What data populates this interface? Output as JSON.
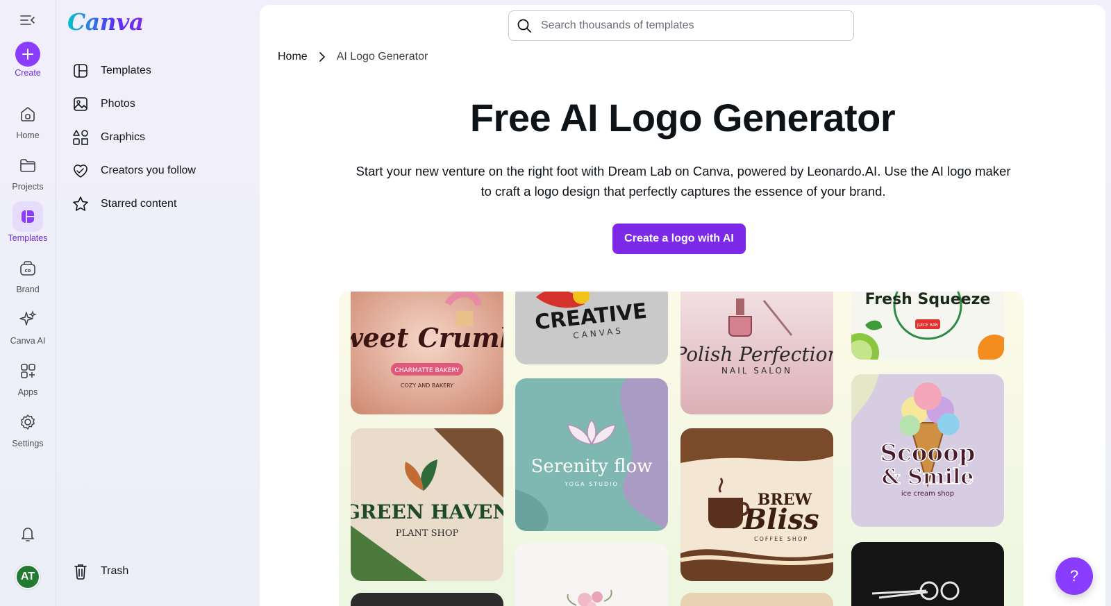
{
  "rail": {
    "create": "Create",
    "items": [
      {
        "label": "Home",
        "icon": "home-icon"
      },
      {
        "label": "Projects",
        "icon": "folder-icon"
      },
      {
        "label": "Templates",
        "icon": "templates-icon"
      },
      {
        "label": "Brand",
        "icon": "brand-icon"
      },
      {
        "label": "Canva AI",
        "icon": "sparkle-icon"
      },
      {
        "label": "Apps",
        "icon": "apps-icon"
      },
      {
        "label": "Settings",
        "icon": "gear-icon"
      }
    ],
    "active": "Templates",
    "avatar": "AT"
  },
  "panel": {
    "logo": "Canva",
    "nav": [
      {
        "label": "Templates",
        "icon": "templates-outline-icon"
      },
      {
        "label": "Photos",
        "icon": "photo-icon"
      },
      {
        "label": "Graphics",
        "icon": "shapes-icon"
      },
      {
        "label": "Creators you follow",
        "icon": "heart-icon"
      },
      {
        "label": "Starred content",
        "icon": "star-icon"
      }
    ],
    "trash": "Trash"
  },
  "main": {
    "search_placeholder": "Search thousands of templates",
    "breadcrumb": {
      "home": "Home",
      "current": "AI Logo Generator"
    },
    "title": "Free AI Logo Generator",
    "description": "Start your new venture on the right foot with Dream Lab on Canva, powered by Leonardo.AI. Use the AI logo maker to craft a logo design that perfectly captures the essence of your brand.",
    "cta": "Create a logo with AI",
    "logos": [
      {
        "name": "Sweet Crumbs",
        "sub": "CHARMATTE BAKERY",
        "sub2": "COZY AND BAKERY"
      },
      {
        "name": "CREATIVE",
        "sub": "CANVAS"
      },
      {
        "name": "Polish Perfection",
        "sub": "NAIL SALON"
      },
      {
        "name": "Fresh Squeeze",
        "sub": "JUICE BAR"
      },
      {
        "name": "GREEN HAVEN",
        "sub": "PLANT SHOP"
      },
      {
        "name": "Serenity flow",
        "sub": "YOGA STUDIO"
      },
      {
        "name": "BREW",
        "name2": "Bliss",
        "sub": "COFFEE SHOP"
      },
      {
        "name": "Scooop",
        "name2": "& Smile",
        "sub": "ice cream shop"
      }
    ]
  },
  "help": "?"
}
